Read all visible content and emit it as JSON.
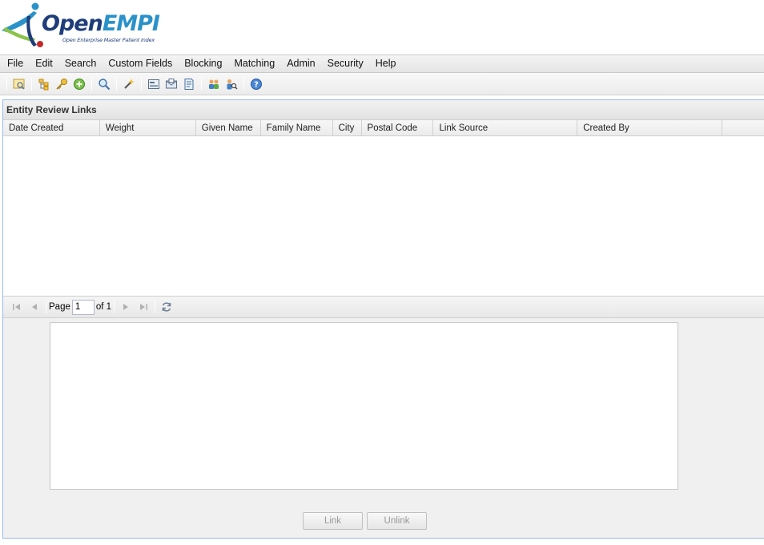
{
  "logo": {
    "brand_open": "Open",
    "brand_empi": "EMPI",
    "tagline": "Open Enterprise Master Patient Index"
  },
  "menu": [
    "File",
    "Edit",
    "Search",
    "Custom Fields",
    "Blocking",
    "Matching",
    "Admin",
    "Security",
    "Help"
  ],
  "toolbar_icons": [
    "search-window-icon",
    "tree-icon",
    "key-icon",
    "add-circle-icon",
    "magnifier-icon",
    "magic-wand-icon",
    "form-icon",
    "mail-icon",
    "document-icon",
    "users-icon",
    "user-search-icon",
    "help-icon"
  ],
  "panel": {
    "title": "Entity Review Links",
    "columns": [
      "Date Created",
      "Weight",
      "Given Name",
      "Family Name",
      "City",
      "Postal Code",
      "Link Source",
      "Created By"
    ],
    "rows": []
  },
  "pager": {
    "page_label": "Page",
    "page_value": "1",
    "of_label": "of 1"
  },
  "buttons": {
    "link": "Link",
    "unlink": "Unlink"
  }
}
